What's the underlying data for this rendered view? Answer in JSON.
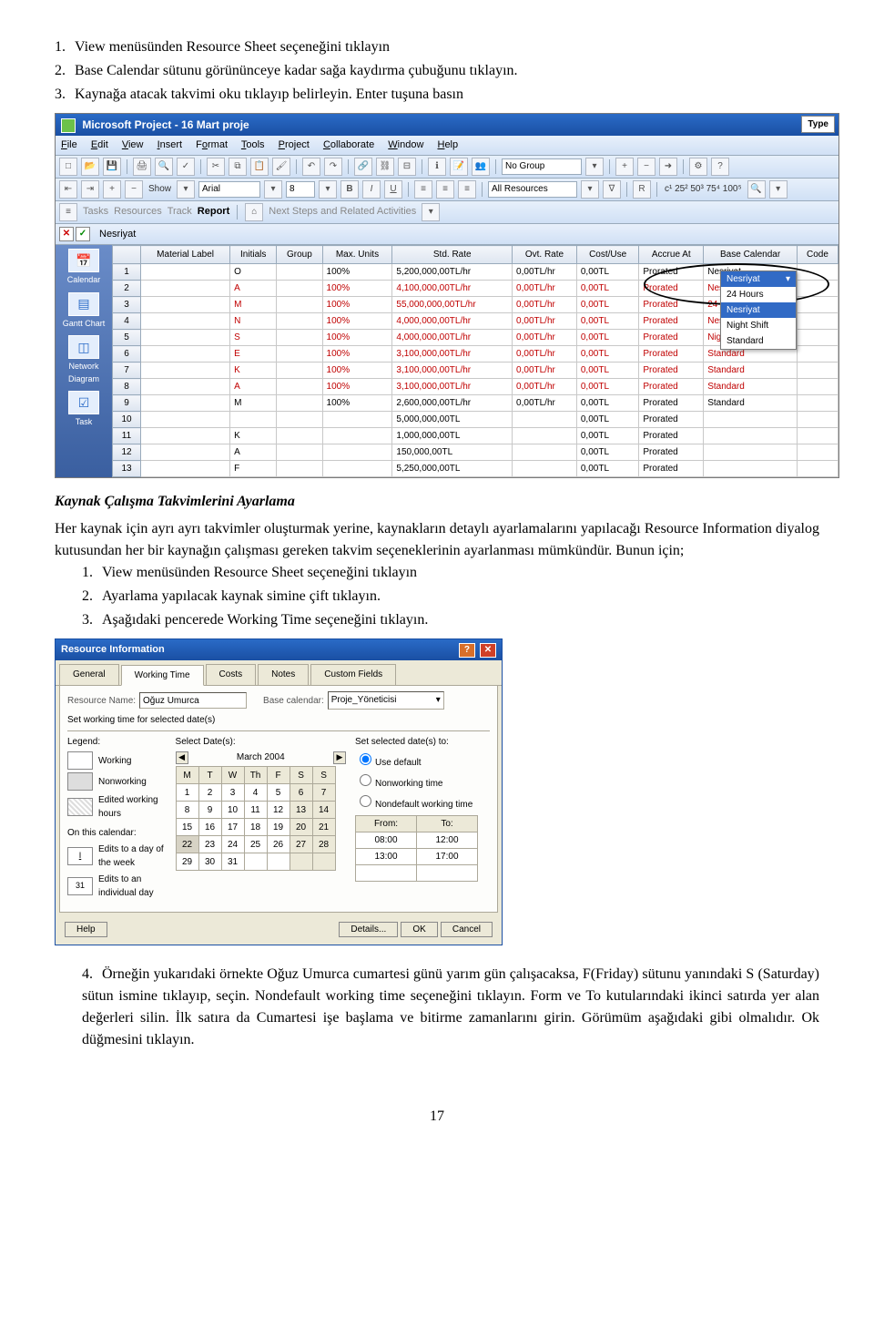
{
  "intro_list": [
    "View menüsünden Resource Sheet seçeneğini tıklayın",
    "Base Calendar sütunu görününceye kadar sağa kaydırma çubuğunu tıklayın.",
    "Kaynağa atacak takvimi oku tıklayıp belirleyin. Enter tuşuna basın"
  ],
  "heading1": "Kaynak Çalışma Takvimlerini Ayarlama",
  "para1": "Her kaynak için ayrı ayrı takvimler oluşturmak yerine,  kaynakların detaylı ayarlamalarını yapılacağı Resource Information diyalog kutusundan her bir kaynağın çalışması gereken takvim seçeneklerinin ayarlanması mümkündür. Bunun için;",
  "steps2": [
    "View menüsünden Resource Sheet seçeneğini tıklayın",
    "Ayarlama yapılacak kaynak simine çift tıklayın.",
    "Aşağıdaki pencerede Working Time seçeneğini tıklayın."
  ],
  "para2": "Örneğin yukarıdaki örnekte Oğuz Umurca cumartesi günü yarım gün çalışacaksa,  F(Friday) sütunu yanındaki S (Saturday) sütun ismine tıklayıp, seçin.  Nondefault working time seçeneğini tıklayın. Form ve To kutularındaki ikinci satırda yer alan değerleri silin.  İlk satıra da Cumartesi işe başlama ve bitirme zamanlarını girin.  Görümüm aşağıdaki gibi olmalıdır. Ok düğmesini tıklayın.",
  "page_number": "17",
  "proj": {
    "title": "Microsoft Project - 16 Mart proje",
    "type_label": "Type",
    "menus": [
      "File",
      "Edit",
      "View",
      "Insert",
      "Format",
      "Tools",
      "Project",
      "Collaborate",
      "Window",
      "Help"
    ],
    "toolbar1": {
      "show_label": "Show",
      "font_name": "Arial",
      "font_size": "8",
      "group_label": "No Group"
    },
    "toolbar2": {
      "filter": "All Resources"
    },
    "tabs": [
      "Tasks",
      "Resources",
      "Track",
      "Report"
    ],
    "subbar_label": "Next Steps and Related Activities",
    "editbar_value": "Nesriyat",
    "columns": [
      "",
      "Material Label",
      "Initials",
      "Group",
      "Max. Units",
      "Std. Rate",
      "Ovt. Rate",
      "Cost/Use",
      "Accrue At",
      "Base Calendar",
      "Code"
    ],
    "rows": [
      {
        "n": "1",
        "ml": "",
        "ini": "O",
        "grp": "",
        "max": "100%",
        "std": "5,200,000,00TL/hr",
        "ovt": "0,00TL/hr",
        "cu": "0,00TL",
        "acc": "Prorated",
        "bc": "Nesriyat",
        "code": ""
      },
      {
        "n": "2",
        "ml": "",
        "ini": "A",
        "grp": "",
        "max": "100%",
        "std": "4,100,000,00TL/hr",
        "ovt": "0,00TL/hr",
        "cu": "0,00TL",
        "acc": "Prorated",
        "bc": "Nesriyat",
        "code": "",
        "red": true
      },
      {
        "n": "3",
        "ml": "",
        "ini": "M",
        "grp": "",
        "max": "100%",
        "std": "55,000,000,00TL/hr",
        "ovt": "0,00TL/hr",
        "cu": "0,00TL",
        "acc": "Prorated",
        "bc": "24 Hours",
        "code": "",
        "red": true
      },
      {
        "n": "4",
        "ml": "",
        "ini": "N",
        "grp": "",
        "max": "100%",
        "std": "4,000,000,00TL/hr",
        "ovt": "0,00TL/hr",
        "cu": "0,00TL",
        "acc": "Prorated",
        "bc": "Nesriyat",
        "code": "",
        "red": true
      },
      {
        "n": "5",
        "ml": "",
        "ini": "S",
        "grp": "",
        "max": "100%",
        "std": "4,000,000,00TL/hr",
        "ovt": "0,00TL/hr",
        "cu": "0,00TL",
        "acc": "Prorated",
        "bc": "Night Shift",
        "code": "",
        "red": true
      },
      {
        "n": "6",
        "ml": "",
        "ini": "E",
        "grp": "",
        "max": "100%",
        "std": "3,100,000,00TL/hr",
        "ovt": "0,00TL/hr",
        "cu": "0,00TL",
        "acc": "Prorated",
        "bc": "Standard",
        "code": "",
        "red": true
      },
      {
        "n": "7",
        "ml": "",
        "ini": "K",
        "grp": "",
        "max": "100%",
        "std": "3,100,000,00TL/hr",
        "ovt": "0,00TL/hr",
        "cu": "0,00TL",
        "acc": "Prorated",
        "bc": "Standard",
        "code": "",
        "red": true
      },
      {
        "n": "8",
        "ml": "",
        "ini": "A",
        "grp": "",
        "max": "100%",
        "std": "3,100,000,00TL/hr",
        "ovt": "0,00TL/hr",
        "cu": "0,00TL",
        "acc": "Prorated",
        "bc": "Standard",
        "code": "",
        "red": true
      },
      {
        "n": "9",
        "ml": "",
        "ini": "M",
        "grp": "",
        "max": "100%",
        "std": "2,600,000,00TL/hr",
        "ovt": "0,00TL/hr",
        "cu": "0,00TL",
        "acc": "Prorated",
        "bc": "Standard",
        "code": ""
      },
      {
        "n": "10",
        "ml": "",
        "ini": "",
        "grp": "",
        "max": "",
        "std": "5,000,000,00TL",
        "ovt": "",
        "cu": "0,00TL",
        "acc": "Prorated",
        "bc": "",
        "code": ""
      },
      {
        "n": "11",
        "ml": "",
        "ini": "K",
        "grp": "",
        "max": "",
        "std": "1,000,000,00TL",
        "ovt": "",
        "cu": "0,00TL",
        "acc": "Prorated",
        "bc": "",
        "code": ""
      },
      {
        "n": "12",
        "ml": "",
        "ini": "A",
        "grp": "",
        "max": "",
        "std": "150,000,00TL",
        "ovt": "",
        "cu": "0,00TL",
        "acc": "Prorated",
        "bc": "",
        "code": ""
      },
      {
        "n": "13",
        "ml": "",
        "ini": "F",
        "grp": "",
        "max": "",
        "std": "5,250,000,00TL",
        "ovt": "",
        "cu": "0,00TL",
        "acc": "Prorated",
        "bc": "",
        "code": ""
      }
    ],
    "sidebar": [
      {
        "label": "Calendar"
      },
      {
        "label": "Gantt Chart"
      },
      {
        "label": "Network Diagram"
      },
      {
        "label": "Task"
      }
    ],
    "dropdown": {
      "top": "Nesriyat",
      "items": [
        "24 Hours",
        "Nesriyat",
        "Night Shift",
        "Standard"
      ],
      "selected": "Nesriyat"
    }
  },
  "dlg": {
    "title": "Resource Information",
    "tabs": [
      "General",
      "Working Time",
      "Costs",
      "Notes",
      "Custom Fields"
    ],
    "active_tab": 1,
    "resource_name_label": "Resource Name:",
    "resource_name": "Oğuz Umurca",
    "base_calendar_label": "Base calendar:",
    "base_calendar": "Proje_Yöneticisi",
    "set_label": "Set working time for selected date(s)",
    "legend_label": "Legend:",
    "legend": [
      "Working",
      "Nonworking",
      "Edited working hours"
    ],
    "on_calendar_label": "On this calendar:",
    "on_calendar_items": [
      "Edits to a day of the week",
      "Edits to an individual day"
    ],
    "on_calendar_icons": [
      "I",
      "31"
    ],
    "select_dates_label": "Select Date(s):",
    "month": "March 2004",
    "weekdays": [
      "M",
      "T",
      "W",
      "Th",
      "F",
      "S",
      "S"
    ],
    "weeks": [
      [
        "1",
        "2",
        "3",
        "4",
        "5",
        "6",
        "7"
      ],
      [
        "8",
        "9",
        "10",
        "11",
        "12",
        "13",
        "14"
      ],
      [
        "15",
        "16",
        "17",
        "18",
        "19",
        "20",
        "21"
      ],
      [
        "22",
        "23",
        "24",
        "25",
        "26",
        "27",
        "28"
      ],
      [
        "29",
        "30",
        "31",
        "",
        "",
        "",
        ""
      ]
    ],
    "set_selected_label": "Set selected date(s) to:",
    "radios": [
      "Use default",
      "Nonworking time",
      "Nondefault working time"
    ],
    "radio_checked": 0,
    "from_label": "From:",
    "to_label": "To:",
    "times": [
      [
        "08:00",
        "12:00"
      ],
      [
        "13:00",
        "17:00"
      ]
    ],
    "buttons": {
      "help": "Help",
      "details": "Details...",
      "ok": "OK",
      "cancel": "Cancel"
    }
  }
}
